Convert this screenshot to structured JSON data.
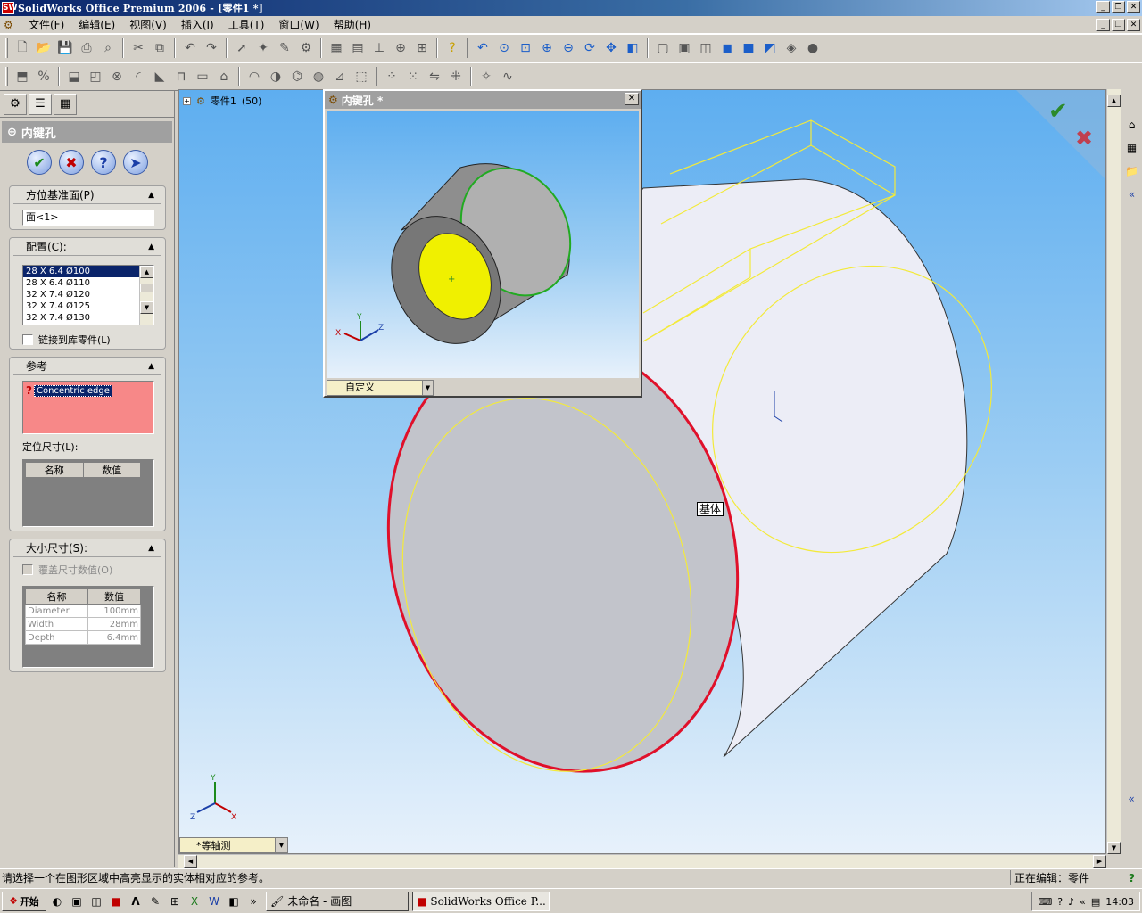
{
  "window": {
    "title": "SolidWorks Office Premium 2006 - [零件1 *]",
    "app_icon_label": "SW"
  },
  "menu": {
    "items": [
      "文件(F)",
      "编辑(E)",
      "视图(V)",
      "插入(I)",
      "工具(T)",
      "窗口(W)",
      "帮助(H)"
    ]
  },
  "left_panel": {
    "tabs": [
      "feature-tree-tab",
      "property-manager-tab",
      "configuration-manager-tab"
    ],
    "header": "内键孔",
    "buttons": {
      "ok": "✔",
      "cancel": "✖",
      "help": "?",
      "pin": "➤"
    },
    "orientation": {
      "title": "方位基准面(P)",
      "value": "面<1>"
    },
    "configuration": {
      "title": "配置(C):",
      "items": [
        "28 X 6.4  Ø100",
        "28 X 6.4  Ø110",
        "32 X 7.4  Ø120",
        "32 X 7.4  Ø125",
        "32 X 7.4  Ø130"
      ],
      "selected_index": 0,
      "link_label": "链接到库零件(L)"
    },
    "reference": {
      "title": "参考",
      "item": "Concentric edge",
      "locate_dims_label": "定位尺寸(L):",
      "columns": [
        "名称",
        "数值"
      ]
    },
    "size_dims": {
      "title": "大小尺寸(S):",
      "override_label": "覆盖尺寸数值(O)",
      "columns": [
        "名称",
        "数值"
      ],
      "rows": [
        {
          "name": "Diameter",
          "value": "100mm"
        },
        {
          "name": "Width",
          "value": "28mm"
        },
        {
          "name": "Depth",
          "value": "6.4mm"
        }
      ]
    }
  },
  "graphics": {
    "tree_root": "零件1",
    "tree_root_suffix": "(50)",
    "view_orientation": "*等轴测",
    "base_label": "基体",
    "colors": {
      "sky_top": "#5eaef0",
      "highlight_edge": "#e0102a",
      "sketch_line": "#f3ea3a"
    }
  },
  "preview": {
    "title": "内键孔 *",
    "view_select": "自定义"
  },
  "statusbar": {
    "message": "请选择一个在图形区域中高亮显示的实体相对应的参考。",
    "editing": "正在编辑：零件"
  },
  "taskbar": {
    "start": "开始",
    "tasks": [
      {
        "label": "未命名 - 画图",
        "active": false
      },
      {
        "label": "SolidWorks Office P...",
        "active": true
      }
    ],
    "chevron": "»",
    "tray_chevron": "«",
    "time": "14:03"
  }
}
